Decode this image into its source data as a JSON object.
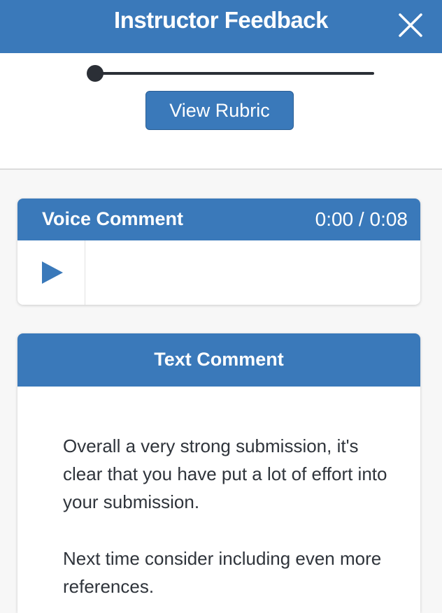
{
  "header": {
    "title": "Instructor Feedback",
    "close_icon": "close-icon"
  },
  "rubric": {
    "button_label": "View Rubric"
  },
  "voice_comment": {
    "title": "Voice Comment",
    "time_display": "0:00 / 0:08",
    "play_icon": "play-icon",
    "progress": 0
  },
  "text_comment": {
    "title": "Text Comment",
    "paragraphs": [
      "Overall a very strong submission, it's clear that you have put a lot of effort into your submission.",
      "Next time consider including even more references."
    ]
  },
  "colors": {
    "primary": "#3a79ba",
    "background": "#f7f7f7",
    "text": "#2f343b"
  }
}
